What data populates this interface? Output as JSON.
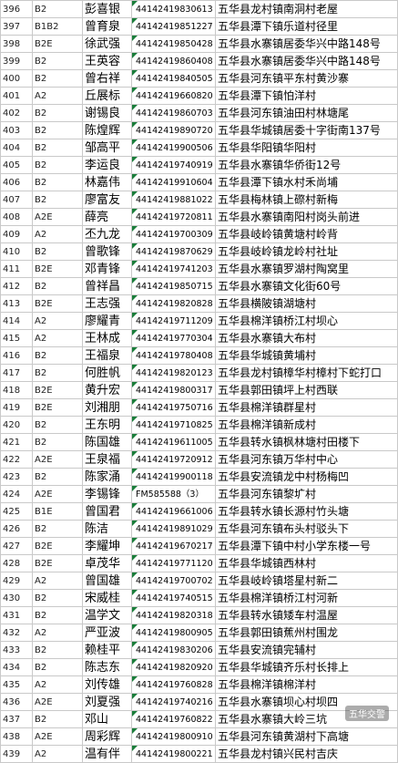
{
  "rows": [
    {
      "no": "396",
      "cls": "B2",
      "name": "彭喜银",
      "id": "44142419830613",
      "addr": "五华县龙村镇南洞村老屋"
    },
    {
      "no": "397",
      "cls": "B1B2",
      "name": "曾育泉",
      "id": "44142419851227",
      "addr": "五华县潭下镇乐道村径里"
    },
    {
      "no": "398",
      "cls": "B2E",
      "name": "徐武强",
      "id": "44142419850428",
      "addr": "五华县水寨镇居委华兴中路148号"
    },
    {
      "no": "399",
      "cls": "B2",
      "name": "王英容",
      "id": "44142419860408",
      "addr": "五华县水寨镇居委华兴中路148号"
    },
    {
      "no": "400",
      "cls": "B2",
      "name": "曾右祥",
      "id": "44142419840505",
      "addr": "五华县河东镇平东村黄沙寨"
    },
    {
      "no": "401",
      "cls": "A2",
      "name": "丘展标",
      "id": "44142419660820",
      "addr": "五华县潭下镇怕洋村"
    },
    {
      "no": "402",
      "cls": "B2",
      "name": "谢锡良",
      "id": "44142419860703",
      "addr": "五华县河东镇油田村林塘尾"
    },
    {
      "no": "403",
      "cls": "B2",
      "name": "陈煌辉",
      "id": "44142419890720",
      "addr": "五华县华城镇居委十字街南137号"
    },
    {
      "no": "404",
      "cls": "B2",
      "name": "邹高平",
      "id": "44142419900506",
      "addr": "五华县华阳镇华阳村"
    },
    {
      "no": "405",
      "cls": "B2",
      "name": "李运良",
      "id": "44142419740919",
      "addr": "五华县水寨镇华侨街12号"
    },
    {
      "no": "406",
      "cls": "B2",
      "name": "林嘉伟",
      "id": "44142419910604",
      "addr": "五华县潭下镇水村禾尚埔"
    },
    {
      "no": "407",
      "cls": "B2",
      "name": "廖富友",
      "id": "44142419881022",
      "addr": "五华县梅林镇上磜村新梅"
    },
    {
      "no": "408",
      "cls": "A2E",
      "name": "薛亮",
      "id": "44142419720811",
      "addr": "五华县水寨镇南阳村岗头前进"
    },
    {
      "no": "409",
      "cls": "A2",
      "name": "丕九龙",
      "id": "44142419700309",
      "addr": "五华县岐岭镇黄塘村岭背"
    },
    {
      "no": "410",
      "cls": "B2",
      "name": "曾歌锋",
      "id": "44142419870629",
      "addr": "五华县岐岭镇龙岭村社址"
    },
    {
      "no": "411",
      "cls": "B2E",
      "name": "邓青锋",
      "id": "44142419741203",
      "addr": "五华县水寨镇罗湖村陶窝里"
    },
    {
      "no": "412",
      "cls": "B2",
      "name": "曾祥昌",
      "id": "44142419850715",
      "addr": "五华县水寨镇文化街60号"
    },
    {
      "no": "413",
      "cls": "B2E",
      "name": "王志强",
      "id": "44142419820828",
      "addr": "五华县横陂镇湖塘村"
    },
    {
      "no": "414",
      "cls": "A2",
      "name": "廖耀青",
      "id": "44142419711209",
      "addr": "五华县棉洋镇桥江村坝心"
    },
    {
      "no": "415",
      "cls": "A2",
      "name": "王林成",
      "id": "44142419770304",
      "addr": "五华县水寨镇大布村"
    },
    {
      "no": "416",
      "cls": "B2",
      "name": "王福泉",
      "id": "44142419780408",
      "addr": "五华县华城镇黄埔村"
    },
    {
      "no": "417",
      "cls": "B2",
      "name": "何胜帆",
      "id": "44142419820123",
      "addr": "五华县龙村镇樟华村樟村下蛇打口"
    },
    {
      "no": "418",
      "cls": "B2E",
      "name": "黄升宏",
      "id": "44142419800317",
      "addr": "五华县郭田镇坪上村西联"
    },
    {
      "no": "419",
      "cls": "B2E",
      "name": "刘湘朋",
      "id": "44142419750716",
      "addr": "五华县棉洋镇群星村"
    },
    {
      "no": "420",
      "cls": "B2",
      "name": "王东明",
      "id": "44142419710825",
      "addr": "五华县棉洋镇新成村"
    },
    {
      "no": "421",
      "cls": "B2",
      "name": "陈国雄",
      "id": "44142419611005",
      "addr": "五华县转水镇枫林塘村田楼下"
    },
    {
      "no": "422",
      "cls": "A2E",
      "name": "王泉福",
      "id": "44142419720912",
      "addr": "五华县河东镇万华村中心"
    },
    {
      "no": "423",
      "cls": "B2",
      "name": "陈家涌",
      "id": "44142419900118",
      "addr": "五华县安流镇龙中村杨梅凹"
    },
    {
      "no": "424",
      "cls": "A2E",
      "name": "李锡锋",
      "id": "FM585588（3）",
      "addr": "五华县河东镇黎圹村"
    },
    {
      "no": "425",
      "cls": "B1E",
      "name": "曾国君",
      "id": "44142419661006",
      "addr": "五华县转水镇长源村竹头塘"
    },
    {
      "no": "426",
      "cls": "B2",
      "name": "陈洁",
      "id": "44142419891029",
      "addr": "五华县河东镇布头村驳头下"
    },
    {
      "no": "427",
      "cls": "B2E",
      "name": "李耀坤",
      "id": "44142419670217",
      "addr": "五华县潭下镇中村小学东楼一号"
    },
    {
      "no": "428",
      "cls": "B2E",
      "name": "卓茂华",
      "id": "44142419771120",
      "addr": "五华县华城镇西林村"
    },
    {
      "no": "429",
      "cls": "A2",
      "name": "曾国雄",
      "id": "44142419700702",
      "addr": "五华县岐岭镇塔星村新二"
    },
    {
      "no": "430",
      "cls": "B2",
      "name": "宋威桂",
      "id": "44142419740515",
      "addr": "五华县棉洋镇桥江村河新"
    },
    {
      "no": "431",
      "cls": "B2",
      "name": "温学文",
      "id": "44142419820318",
      "addr": "五华县转水镇矮车村温屋"
    },
    {
      "no": "432",
      "cls": "A2",
      "name": "严亚波",
      "id": "44142419800905",
      "addr": "五华县郭田镇蕉州村围龙"
    },
    {
      "no": "433",
      "cls": "B2",
      "name": "赖桂平",
      "id": "44142419830206",
      "addr": "五华县安流镇完辅村"
    },
    {
      "no": "434",
      "cls": "B2",
      "name": "陈志东",
      "id": "44142419820920",
      "addr": "五华县华城镇齐乐村长排上"
    },
    {
      "no": "435",
      "cls": "A2",
      "name": "刘传雄",
      "id": "44142419760828",
      "addr": "五华县棉洋镇棉洋村"
    },
    {
      "no": "436",
      "cls": "A2E",
      "name": "刘夏强",
      "id": "44142419740216",
      "addr": "五华县水寨镇坝心村坝四"
    },
    {
      "no": "437",
      "cls": "B2",
      "name": "邓山",
      "id": "44142419760822",
      "addr": "五华县水寨镇大岭三坑"
    },
    {
      "no": "438",
      "cls": "A2E",
      "name": "周彩辉",
      "id": "44142419800910",
      "addr": "五华县河东镇黄湖村下高塘"
    },
    {
      "no": "439",
      "cls": "A2",
      "name": "温有伴",
      "id": "44142419800221",
      "addr": "五华县龙村镇兴民村吉庆"
    }
  ],
  "watermark": "五华交警"
}
